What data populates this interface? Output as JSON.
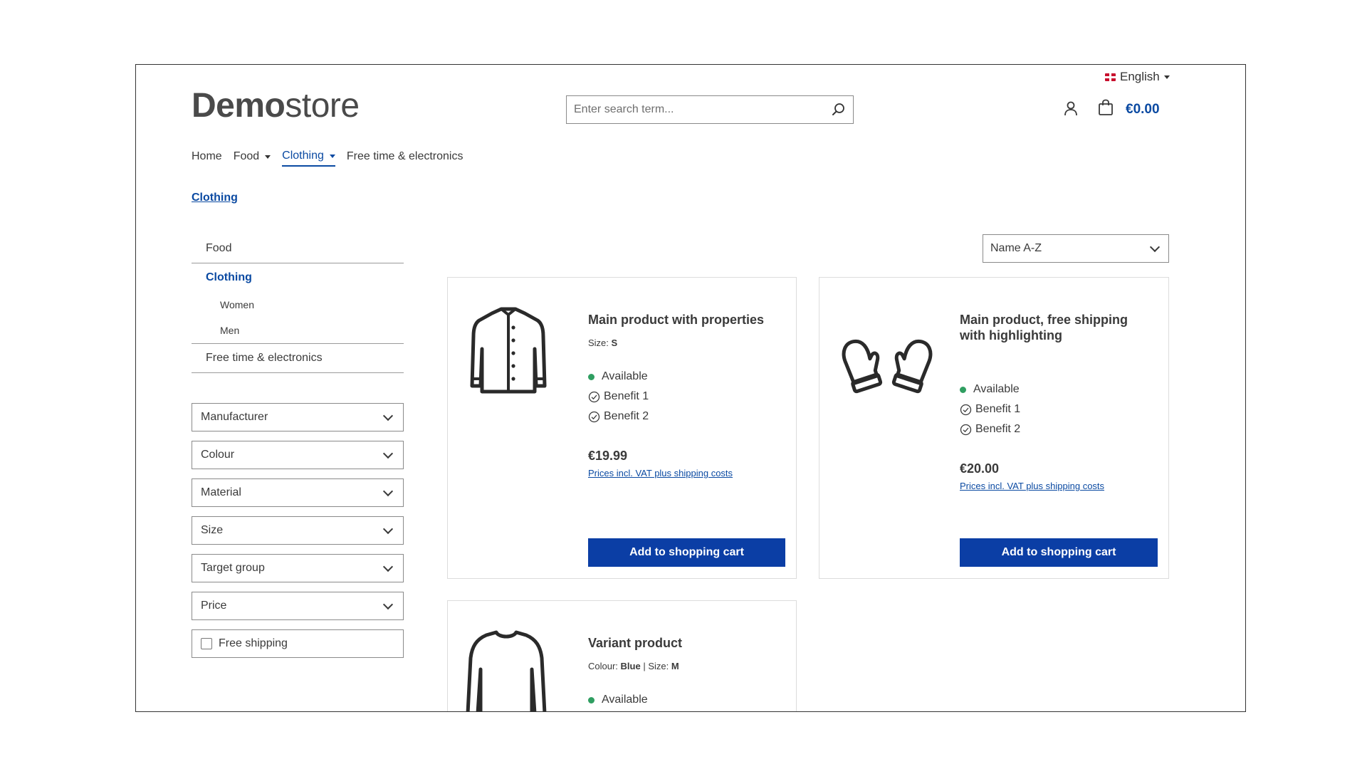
{
  "header": {
    "language": "English",
    "logo_bold": "Demo",
    "logo_light": "store",
    "search_placeholder": "Enter search term...",
    "cart_total": "€0.00"
  },
  "nav": {
    "items": [
      {
        "label": "Home"
      },
      {
        "label": "Food"
      },
      {
        "label": "Clothing"
      },
      {
        "label": "Free time & electronics"
      }
    ]
  },
  "breadcrumb": "Clothing",
  "sidebar": {
    "categories": {
      "food": "Food",
      "clothing": "Clothing",
      "women": "Women",
      "men": "Men",
      "free_time": "Free time & electronics"
    },
    "filters": [
      "Manufacturer",
      "Colour",
      "Material",
      "Size",
      "Target group",
      "Price"
    ],
    "free_shipping": "Free shipping"
  },
  "sort": {
    "selected": "Name A-Z"
  },
  "products": [
    {
      "name": "Main product with properties",
      "prop_label": "Size:",
      "prop_value": "S",
      "availability": "Available",
      "benefit1": "Benefit 1",
      "benefit2": "Benefit 2",
      "price": "€19.99",
      "vat": "Prices incl. VAT plus shipping costs",
      "button": "Add to shopping cart"
    },
    {
      "name_line1": "Main product, free shipping",
      "name_line2": "with highlighting",
      "availability": "Available",
      "benefit1": "Benefit 1",
      "benefit2": "Benefit 2",
      "price": "€20.00",
      "vat": "Prices incl. VAT plus shipping costs",
      "button": "Add to shopping cart"
    },
    {
      "name": "Variant product",
      "prop1_label": "Colour:",
      "prop1_value": "Blue",
      "prop2_label": "Size:",
      "prop2_value": "M",
      "availability": "Available"
    }
  ],
  "colors": {
    "accent": "#0b4aa2",
    "button": "#0b3ea5",
    "available": "#2f9e61"
  },
  "icons": [
    "flag-uk-icon",
    "search-icon",
    "account-icon",
    "cart-icon",
    "chevron-down-icon",
    "check-circle-icon",
    "jacket-icon",
    "mittens-icon",
    "sweater-icon"
  ]
}
